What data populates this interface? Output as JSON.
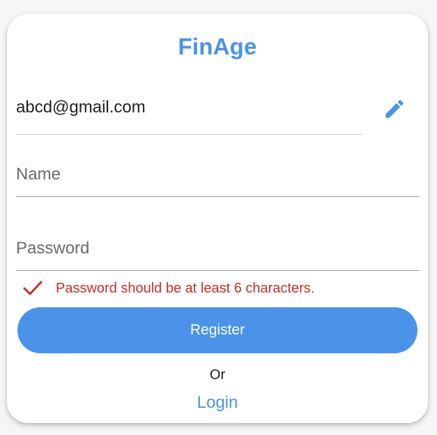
{
  "app": {
    "title": "FinAge"
  },
  "form": {
    "email_value": "abcd@gmail.com",
    "edit_icon": "pencil-icon",
    "name_placeholder": "Name",
    "name_value": "",
    "password_placeholder": "Password",
    "password_value": "",
    "error_icon": "check-icon",
    "error_message": "Password should be at least 6 characters.",
    "register_label": "Register",
    "or_label": "Or",
    "login_label": "Login"
  },
  "colors": {
    "accent": "#4a93e8",
    "error": "#c62d2d",
    "text": "#1f1f1f",
    "placeholder": "#6a6a6a"
  }
}
